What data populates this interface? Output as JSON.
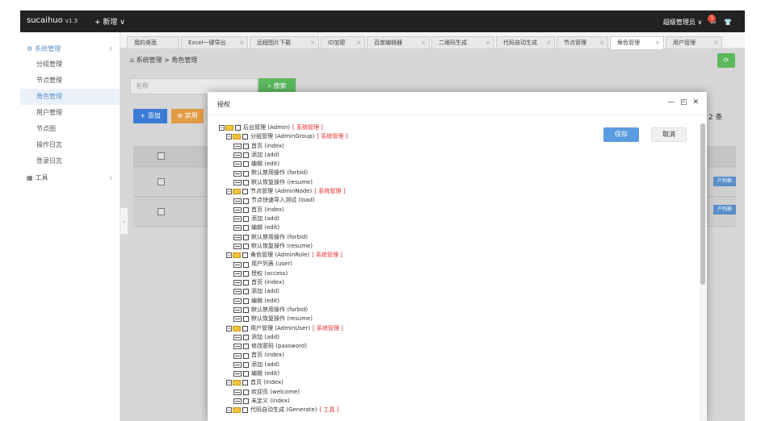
{
  "topbar": {
    "brand": "sucaihuo",
    "version": "v1.3",
    "new_label": "+ 新增 ∨",
    "user_label": "超级管理员 ∨",
    "badge": "1"
  },
  "sidebar": {
    "group1": "系统管理",
    "items": [
      {
        "label": "分组管理",
        "active": false
      },
      {
        "label": "节点管理",
        "active": false
      },
      {
        "label": "角色管理",
        "active": true
      },
      {
        "label": "用户管理",
        "active": false
      },
      {
        "label": "节点图",
        "active": false
      },
      {
        "label": "操作日志",
        "active": false
      },
      {
        "label": "登录日志",
        "active": false
      }
    ],
    "group2": "工具"
  },
  "tabs": [
    {
      "label": "我的桌面"
    },
    {
      "label": "Excel一键导出"
    },
    {
      "label": "远程图片下载"
    },
    {
      "label": "ID加密"
    },
    {
      "label": "百度编辑器"
    },
    {
      "label": "二维码生成"
    },
    {
      "label": "代码自动生成"
    },
    {
      "label": "节点管理"
    },
    {
      "label": "角色管理"
    },
    {
      "label": "用户管理"
    }
  ],
  "content": {
    "breadcrumb": "系统管理 > 角色管理",
    "search_placeholder": "名称",
    "search_button": "搜索",
    "add_button": "+ 添加",
    "disable_button": "禁用",
    "count_text": "：2 条",
    "perm_tag": "户列表"
  },
  "modal": {
    "title": "授权",
    "save": "保存",
    "cancel": "取消",
    "tree": [
      {
        "level": 0,
        "kind": "folder",
        "label": "后台管理 (Admin)",
        "tag": "[ 系统管理 ]"
      },
      {
        "level": 1,
        "kind": "folder",
        "label": "分组管理 (AdminGroup)",
        "tag": "[ 系统管理 ]"
      },
      {
        "level": 2,
        "kind": "leaf",
        "label": "首页 (index)"
      },
      {
        "level": 2,
        "kind": "leaf",
        "label": "添加 (add)"
      },
      {
        "level": 2,
        "kind": "leaf",
        "label": "编辑 (edit)"
      },
      {
        "level": 2,
        "kind": "leaf",
        "label": "默认禁用操作 (forbid)"
      },
      {
        "level": 2,
        "kind": "leaf",
        "label": "默认恢复操作 (resume)"
      },
      {
        "level": 1,
        "kind": "folder",
        "label": "节点管理 (AdminNode)",
        "tag": "[ 系统管理 ]"
      },
      {
        "level": 2,
        "kind": "leaf",
        "label": "节点快速导入测试 (load)"
      },
      {
        "level": 2,
        "kind": "leaf",
        "label": "首页 (index)"
      },
      {
        "level": 2,
        "kind": "leaf",
        "label": "添加 (add)"
      },
      {
        "level": 2,
        "kind": "leaf",
        "label": "编辑 (edit)"
      },
      {
        "level": 2,
        "kind": "leaf",
        "label": "默认禁用操作 (forbid)"
      },
      {
        "level": 2,
        "kind": "leaf",
        "label": "默认恢复操作 (resume)"
      },
      {
        "level": 1,
        "kind": "folder",
        "label": "角色管理 (AdminRole)",
        "tag": "[ 系统管理 ]"
      },
      {
        "level": 2,
        "kind": "leaf",
        "label": "用户列表 (user)"
      },
      {
        "level": 2,
        "kind": "leaf",
        "label": "授权 (access)"
      },
      {
        "level": 2,
        "kind": "leaf",
        "label": "首页 (index)"
      },
      {
        "level": 2,
        "kind": "leaf",
        "label": "添加 (add)"
      },
      {
        "level": 2,
        "kind": "leaf",
        "label": "编辑 (edit)"
      },
      {
        "level": 2,
        "kind": "leaf",
        "label": "默认禁用操作 (forbid)"
      },
      {
        "level": 2,
        "kind": "leaf",
        "label": "默认恢复操作 (resume)"
      },
      {
        "level": 1,
        "kind": "folder",
        "label": "用户管理 (AdminUser)",
        "tag": "[ 系统管理 ]"
      },
      {
        "level": 2,
        "kind": "leaf",
        "label": "添加 (add)"
      },
      {
        "level": 2,
        "kind": "leaf",
        "label": "修改密码 (password)"
      },
      {
        "level": 2,
        "kind": "leaf",
        "label": "首页 (index)"
      },
      {
        "level": 2,
        "kind": "leaf",
        "label": "添加 (add)"
      },
      {
        "level": 2,
        "kind": "leaf",
        "label": "编辑 (edit)"
      },
      {
        "level": 1,
        "kind": "folder",
        "label": "首页 (Index)"
      },
      {
        "level": 2,
        "kind": "leaf",
        "label": "欢迎页 (welcome)"
      },
      {
        "level": 2,
        "kind": "leaf",
        "label": "未定义 (index)"
      },
      {
        "level": 1,
        "kind": "folder",
        "label": "代码自动生成 (Generate)",
        "tag": "[ 工具 ]"
      }
    ]
  },
  "colors": {
    "accent": "#5a8fc8",
    "tag_red": "#e52e2e",
    "green": "#5cb85c"
  }
}
